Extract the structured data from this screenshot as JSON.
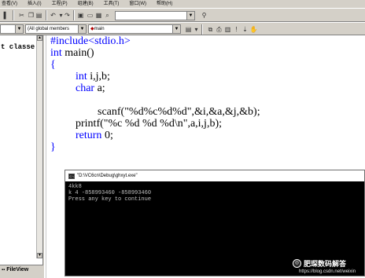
{
  "menu": {
    "items": [
      "查看(V)",
      "插入(I)",
      "工程(P)",
      "组建(B)",
      "工具(T)",
      "窗口(W)",
      "帮助(H)"
    ]
  },
  "toolbar2": {
    "class_combo": "",
    "members_combo": "(All global members",
    "function_combo": "main"
  },
  "classview": {
    "label": "t classe",
    "file_tab": "FileView"
  },
  "editor": {
    "lines": [
      "#include<stdio.h>",
      "int main()",
      "{",
      "int i,j,b;",
      "char a;",
      "",
      "scanf(\"%d%c%d%d\",&i,&a,&j,&b);",
      "printf(\"%c %d %d %d\\n\",a,i,j,b);",
      "return 0;",
      "}"
    ]
  },
  "console": {
    "title": "\"D:\\VC6cn\\Debug\\ghxyt.exe\"",
    "lines": [
      "4kk8",
      "k 4 -858993460 -858993460",
      "Press any key to continue"
    ]
  },
  "watermark": {
    "brand": "肥琛数码解答",
    "url": "https://blog.csdn.net/weixin"
  },
  "colors": {
    "keyword": "#0000ff",
    "console_bg": "#000000",
    "chrome": "#d4d0c8"
  }
}
